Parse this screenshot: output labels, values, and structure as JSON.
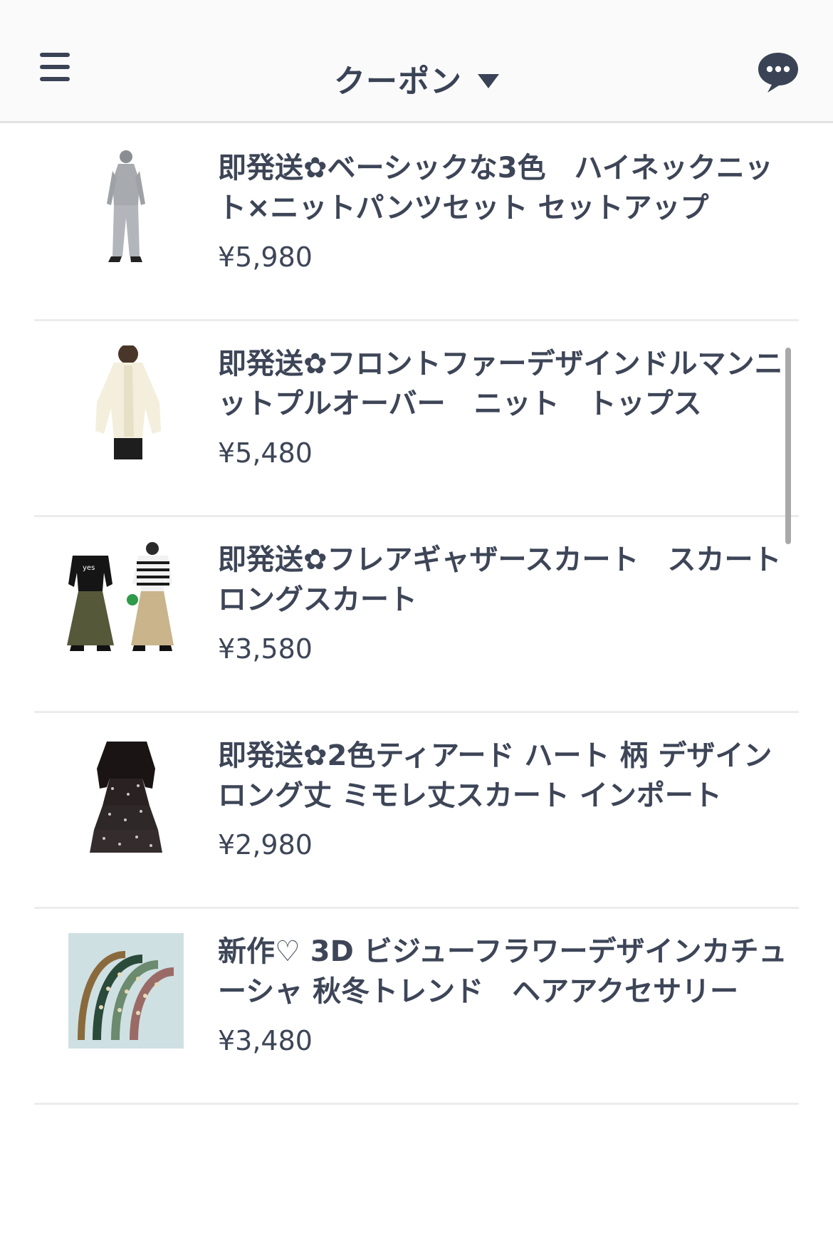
{
  "header": {
    "title": "クーポン",
    "menu_icon": "hamburger-menu-icon",
    "caret_icon": "caret-down-icon",
    "chat_icon": "chat-bubble-icon"
  },
  "products": [
    {
      "name": "即発送✿ベーシックな3色　ハイネックニット×ニットパンツセット セットアップ",
      "price": "¥5,980",
      "image": "gray-knit-setup"
    },
    {
      "name": "即発送✿フロントファーデザインドルマンニットプルオーバー　ニット　トップス",
      "price": "¥5,480",
      "image": "cream-fur-knit"
    },
    {
      "name": "即発送✿フレアギャザースカート　スカート　ロングスカート",
      "price": "¥3,580",
      "image": "flare-skirt-two-models"
    },
    {
      "name": "即発送✿2色ティアード ハート 柄 デザイン ロング丈 ミモレ丈スカート インポート",
      "price": "¥2,980",
      "image": "black-tiered-skirt"
    },
    {
      "name": "新作♡ 3D ビジューフラワーデザインカチューシャ 秋冬トレンド　ヘアアクセサリー",
      "price": "¥3,480",
      "image": "bijou-headbands"
    }
  ],
  "colors": {
    "text": "#3d4557",
    "header_bg": "#fafafa",
    "divider": "#ececec"
  }
}
